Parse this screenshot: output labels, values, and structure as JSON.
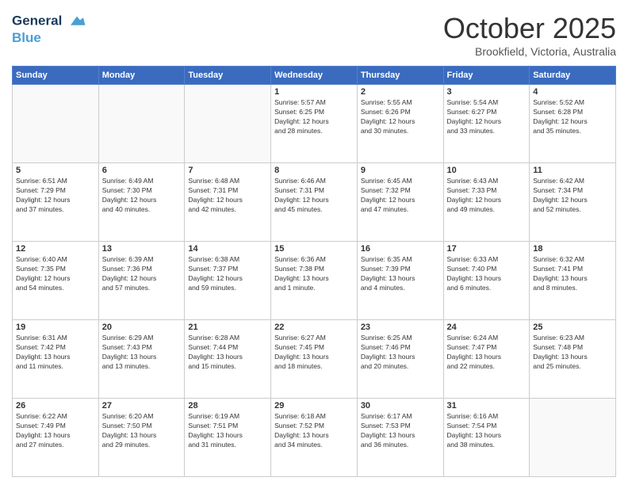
{
  "header": {
    "logo_line1": "General",
    "logo_line2": "Blue",
    "month": "October 2025",
    "location": "Brookfield, Victoria, Australia"
  },
  "days_of_week": [
    "Sunday",
    "Monday",
    "Tuesday",
    "Wednesday",
    "Thursday",
    "Friday",
    "Saturday"
  ],
  "weeks": [
    [
      {
        "day": "",
        "info": ""
      },
      {
        "day": "",
        "info": ""
      },
      {
        "day": "",
        "info": ""
      },
      {
        "day": "1",
        "info": "Sunrise: 5:57 AM\nSunset: 6:25 PM\nDaylight: 12 hours\nand 28 minutes."
      },
      {
        "day": "2",
        "info": "Sunrise: 5:55 AM\nSunset: 6:26 PM\nDaylight: 12 hours\nand 30 minutes."
      },
      {
        "day": "3",
        "info": "Sunrise: 5:54 AM\nSunset: 6:27 PM\nDaylight: 12 hours\nand 33 minutes."
      },
      {
        "day": "4",
        "info": "Sunrise: 5:52 AM\nSunset: 6:28 PM\nDaylight: 12 hours\nand 35 minutes."
      }
    ],
    [
      {
        "day": "5",
        "info": "Sunrise: 6:51 AM\nSunset: 7:29 PM\nDaylight: 12 hours\nand 37 minutes."
      },
      {
        "day": "6",
        "info": "Sunrise: 6:49 AM\nSunset: 7:30 PM\nDaylight: 12 hours\nand 40 minutes."
      },
      {
        "day": "7",
        "info": "Sunrise: 6:48 AM\nSunset: 7:31 PM\nDaylight: 12 hours\nand 42 minutes."
      },
      {
        "day": "8",
        "info": "Sunrise: 6:46 AM\nSunset: 7:31 PM\nDaylight: 12 hours\nand 45 minutes."
      },
      {
        "day": "9",
        "info": "Sunrise: 6:45 AM\nSunset: 7:32 PM\nDaylight: 12 hours\nand 47 minutes."
      },
      {
        "day": "10",
        "info": "Sunrise: 6:43 AM\nSunset: 7:33 PM\nDaylight: 12 hours\nand 49 minutes."
      },
      {
        "day": "11",
        "info": "Sunrise: 6:42 AM\nSunset: 7:34 PM\nDaylight: 12 hours\nand 52 minutes."
      }
    ],
    [
      {
        "day": "12",
        "info": "Sunrise: 6:40 AM\nSunset: 7:35 PM\nDaylight: 12 hours\nand 54 minutes."
      },
      {
        "day": "13",
        "info": "Sunrise: 6:39 AM\nSunset: 7:36 PM\nDaylight: 12 hours\nand 57 minutes."
      },
      {
        "day": "14",
        "info": "Sunrise: 6:38 AM\nSunset: 7:37 PM\nDaylight: 12 hours\nand 59 minutes."
      },
      {
        "day": "15",
        "info": "Sunrise: 6:36 AM\nSunset: 7:38 PM\nDaylight: 13 hours\nand 1 minute."
      },
      {
        "day": "16",
        "info": "Sunrise: 6:35 AM\nSunset: 7:39 PM\nDaylight: 13 hours\nand 4 minutes."
      },
      {
        "day": "17",
        "info": "Sunrise: 6:33 AM\nSunset: 7:40 PM\nDaylight: 13 hours\nand 6 minutes."
      },
      {
        "day": "18",
        "info": "Sunrise: 6:32 AM\nSunset: 7:41 PM\nDaylight: 13 hours\nand 8 minutes."
      }
    ],
    [
      {
        "day": "19",
        "info": "Sunrise: 6:31 AM\nSunset: 7:42 PM\nDaylight: 13 hours\nand 11 minutes."
      },
      {
        "day": "20",
        "info": "Sunrise: 6:29 AM\nSunset: 7:43 PM\nDaylight: 13 hours\nand 13 minutes."
      },
      {
        "day": "21",
        "info": "Sunrise: 6:28 AM\nSunset: 7:44 PM\nDaylight: 13 hours\nand 15 minutes."
      },
      {
        "day": "22",
        "info": "Sunrise: 6:27 AM\nSunset: 7:45 PM\nDaylight: 13 hours\nand 18 minutes."
      },
      {
        "day": "23",
        "info": "Sunrise: 6:25 AM\nSunset: 7:46 PM\nDaylight: 13 hours\nand 20 minutes."
      },
      {
        "day": "24",
        "info": "Sunrise: 6:24 AM\nSunset: 7:47 PM\nDaylight: 13 hours\nand 22 minutes."
      },
      {
        "day": "25",
        "info": "Sunrise: 6:23 AM\nSunset: 7:48 PM\nDaylight: 13 hours\nand 25 minutes."
      }
    ],
    [
      {
        "day": "26",
        "info": "Sunrise: 6:22 AM\nSunset: 7:49 PM\nDaylight: 13 hours\nand 27 minutes."
      },
      {
        "day": "27",
        "info": "Sunrise: 6:20 AM\nSunset: 7:50 PM\nDaylight: 13 hours\nand 29 minutes."
      },
      {
        "day": "28",
        "info": "Sunrise: 6:19 AM\nSunset: 7:51 PM\nDaylight: 13 hours\nand 31 minutes."
      },
      {
        "day": "29",
        "info": "Sunrise: 6:18 AM\nSunset: 7:52 PM\nDaylight: 13 hours\nand 34 minutes."
      },
      {
        "day": "30",
        "info": "Sunrise: 6:17 AM\nSunset: 7:53 PM\nDaylight: 13 hours\nand 36 minutes."
      },
      {
        "day": "31",
        "info": "Sunrise: 6:16 AM\nSunset: 7:54 PM\nDaylight: 13 hours\nand 38 minutes."
      },
      {
        "day": "",
        "info": ""
      }
    ]
  ]
}
